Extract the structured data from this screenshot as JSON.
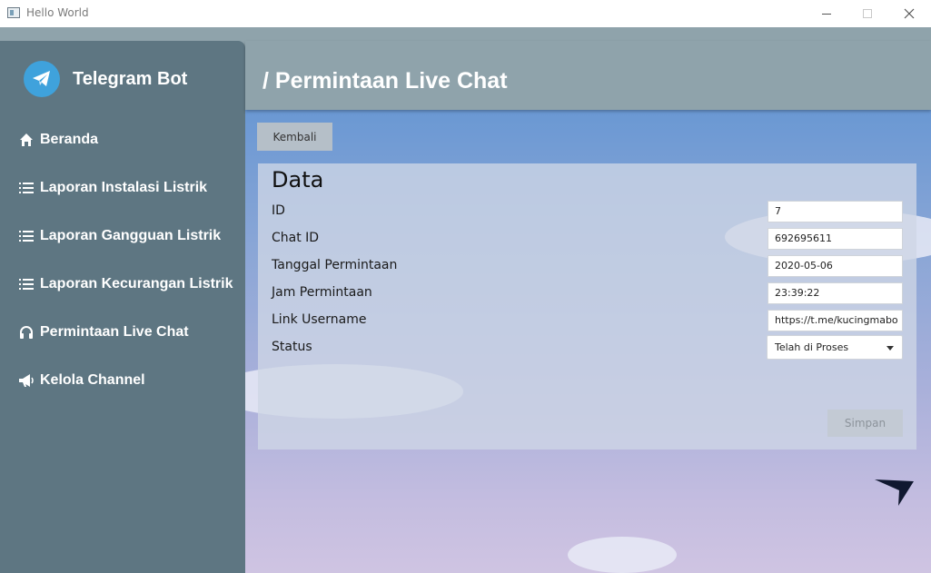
{
  "window": {
    "title": "Hello World"
  },
  "brand": {
    "name": "Telegram Bot",
    "logo_icon": "telegram-icon",
    "logo_color": "#3fa2dc"
  },
  "sidebar": {
    "items": [
      {
        "label": "Beranda",
        "icon": "home-icon"
      },
      {
        "label": "Laporan Instalasi Listrik",
        "icon": "list-icon"
      },
      {
        "label": "Laporan Gangguan Listrik",
        "icon": "list-icon"
      },
      {
        "label": "Laporan Kecurangan Listrik",
        "icon": "list-icon"
      },
      {
        "label": "Permintaan Live Chat",
        "icon": "headset-icon"
      },
      {
        "label": "Kelola Channel",
        "icon": "megaphone-icon"
      }
    ]
  },
  "header": {
    "title": "/ Permintaan Live Chat"
  },
  "toolbar": {
    "back_label": "Kembali"
  },
  "form": {
    "title": "Data",
    "fields": [
      {
        "label": "ID",
        "value": "7"
      },
      {
        "label": "Chat ID",
        "value": "692695611"
      },
      {
        "label": "Tanggal Permintaan",
        "value": "2020-05-06"
      },
      {
        "label": "Jam Permintaan",
        "value": "23:39:22"
      },
      {
        "label": "Link Username",
        "value": "https://t.me/kucingmabo"
      }
    ],
    "status": {
      "label": "Status",
      "value": "Telah di Proses"
    },
    "save_label": "Simpan"
  },
  "colors": {
    "sidebar": "#5e7682",
    "header": "#8fa3ab",
    "content_top": "#6a98d3",
    "content_bottom": "#cfc4e2"
  }
}
